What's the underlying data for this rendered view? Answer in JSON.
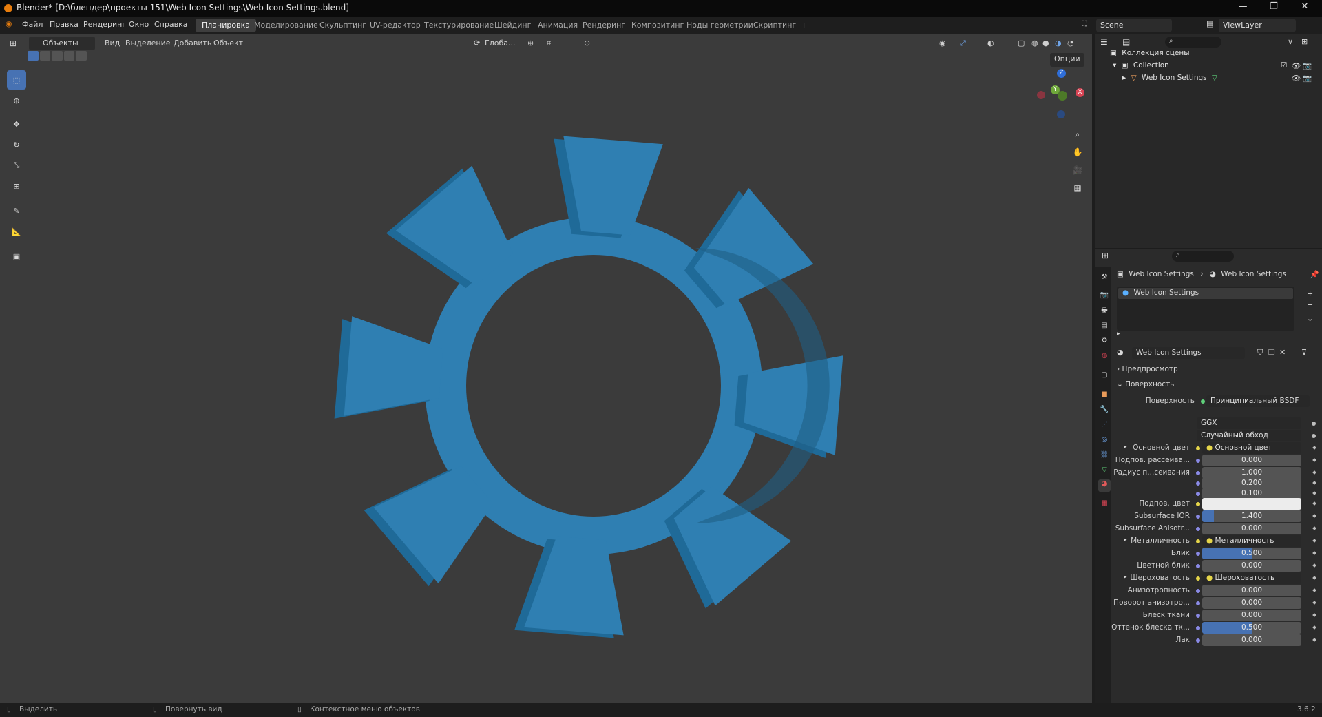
{
  "window": {
    "title": "Blender* [D:\\блендер\\проекты 151\\Web Icon Settings\\Web Icon Settings.blend]",
    "minimize": "—",
    "maximize": "❐",
    "close": "✕"
  },
  "menubar": {
    "items": [
      "Файл",
      "Правка",
      "Рендеринг",
      "Окно",
      "Справка"
    ]
  },
  "workspaces": {
    "active": "Планировка",
    "tabs": [
      "Планировка",
      "Моделирование",
      "Скульптинг",
      "UV-редактор",
      "Текстурирование",
      "Шейдинг",
      "Анимация",
      "Рендеринг",
      "Композитинг",
      "Ноды геометрии",
      "Скриптинг"
    ],
    "add": "+"
  },
  "scene": {
    "name": "Scene",
    "viewlayer": "ViewLayer"
  },
  "viewport_header": {
    "mode": "Объекты",
    "view": "Вид",
    "select": "Выделение",
    "add": "Добавить",
    "object": "Объект",
    "orientation": "Глоба...",
    "options": "Опции"
  },
  "gizmo": {
    "z": "Z",
    "y": "Y",
    "x": "X"
  },
  "object_color": "#2f7fb2",
  "outliner": {
    "root": "Коллекция сцены",
    "collection": "Collection",
    "object": "Web Icon Settings"
  },
  "properties": {
    "breadcrumb": [
      "Web Icon Settings",
      "Web Icon Settings"
    ],
    "material_slot": "Web Icon Settings",
    "material_name": "Web Icon Settings",
    "panels": {
      "preview": "Предпросмотр",
      "surface": "Поверхность"
    },
    "surface": {
      "label": "Поверхность",
      "value": "Принципиальный BSDF"
    },
    "distribution": "GGX",
    "subsurface_method": "Случайный обход",
    "fields": [
      {
        "label": "Основной цвет",
        "type": "link",
        "value": "Основной цвет"
      },
      {
        "label": "Подпов. рассеива...",
        "type": "num",
        "value": "0.000",
        "fill": 0
      },
      {
        "label": "Радиус п...сеивания",
        "type": "num",
        "value": "1.000",
        "fill": 0
      },
      {
        "label": "",
        "type": "num",
        "value": "0.200",
        "fill": 0
      },
      {
        "label": "",
        "type": "num",
        "value": "0.100",
        "fill": 0
      },
      {
        "label": "Подпов. цвет",
        "type": "color",
        "value": "#ececec"
      },
      {
        "label": "Subsurface IOR",
        "type": "num",
        "value": "1.400",
        "fill": 0.12
      },
      {
        "label": "Subsurface Anisotr...",
        "type": "num",
        "value": "0.000",
        "fill": 0
      },
      {
        "label": "Металличность",
        "type": "link",
        "value": "Металличность"
      },
      {
        "label": "Блик",
        "type": "num",
        "value": "0.500",
        "fill": 0.5
      },
      {
        "label": "Цветной блик",
        "type": "num",
        "value": "0.000",
        "fill": 0
      },
      {
        "label": "Шероховатость",
        "type": "link",
        "value": "Шероховатость"
      },
      {
        "label": "Анизотропность",
        "type": "num",
        "value": "0.000",
        "fill": 0
      },
      {
        "label": "Поворот анизотро...",
        "type": "num",
        "value": "0.000",
        "fill": 0
      },
      {
        "label": "Блеск ткани",
        "type": "num",
        "value": "0.000",
        "fill": 0
      },
      {
        "label": "Оттенок блеска тк...",
        "type": "num",
        "value": "0.500",
        "fill": 0.5
      },
      {
        "label": "Лак",
        "type": "num",
        "value": "0.000",
        "fill": 0
      }
    ]
  },
  "statusbar": {
    "select": "Выделить",
    "rotate": "Повернуть вид",
    "context": "Контекстное меню объектов",
    "version": "3.6.2"
  }
}
